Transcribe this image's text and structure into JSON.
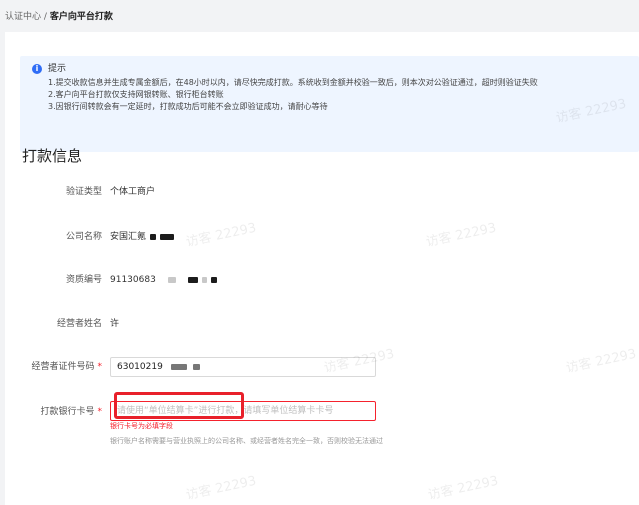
{
  "breadcrumb": {
    "parent": "认证中心",
    "separator": "/",
    "current": "客户向平台打款"
  },
  "notice": {
    "icon": "info-icon",
    "title": "提示",
    "lines": [
      "1.提交收款信息并生成专属金额后，在48小时以内，请尽快完成打款。系统收到金额并校验一致后，则本次对公验证通过，超时则验证失败",
      "2.客户向平台打款仅支持网银转账、银行柜台转账",
      "3.因银行间转款会有一定延时，打款成功后可能不会立即验证成功，请耐心等待"
    ]
  },
  "section_title": "打款信息",
  "fields": {
    "verify_type": {
      "label": "验证类型",
      "value": "个体工商户"
    },
    "company_name": {
      "label": "公司名称",
      "value": "安国汇氪"
    },
    "license_no": {
      "label": "资质编号",
      "value": "91130683"
    },
    "operator_name": {
      "label": "经营者姓名",
      "value": "许"
    },
    "operator_id": {
      "label": "经营者证件号码",
      "value": "63010219",
      "required": "*"
    },
    "bank_card": {
      "label": "打款银行卡号",
      "required": "*",
      "placeholder": "请使用“单位结算卡”进行打款，请填写单位结算卡卡号",
      "error": "银行卡号为必填字段",
      "help": "银行账户名称需要与营业执照上的公司名称、或经营者姓名完全一致，否则校验无法通过"
    }
  },
  "watermark_text": "访客 22293",
  "colors": {
    "accent": "#2f6df6",
    "error": "#f5222d",
    "highlight": "#e8202a",
    "notice_bg": "#eef5ff"
  }
}
